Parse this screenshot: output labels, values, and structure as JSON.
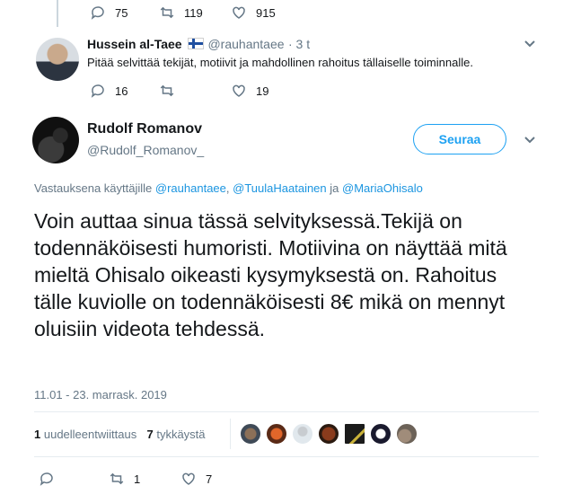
{
  "prev_tweet": {
    "replies": "75",
    "retweets": "119",
    "likes": "915"
  },
  "reply_tweet": {
    "name": "Hussein al-Taee",
    "handle": "@rauhantaee",
    "time": "· 3 t",
    "text": "Pitää selvittää tekijät, motiivit ja mahdollinen rahoitus tällaiselle toiminnalle.",
    "replies": "16",
    "retweets": "",
    "likes": "19"
  },
  "main_tweet": {
    "name": "Rudolf Romanov",
    "handle": "@Rudolf_Romanov_",
    "follow_label": "Seuraa",
    "reply_prefix": "Vastauksena käyttäjille",
    "reply_users": [
      "@rauhantaee",
      "@TuulaHaatainen",
      "@MariaOhisalo"
    ],
    "reply_sep": ",",
    "reply_and": "ja",
    "text": "Voin auttaa sinua tässä selvityksessä.Tekijä on todennäköisesti humoristi.  Motiivina on näyttää mitä mieltä Ohisalo oikeasti kysymyksestä on. Rahoitus tälle kuviolle on todennäköisesti 8€ mikä on mennyt oluisiin videota tehdessä.",
    "timestamp": "11.01 - 23. marrask. 2019",
    "retweet_count": "1",
    "retweet_label": "uudelleentwiittaus",
    "like_count": "7",
    "like_label": "tykkäystä",
    "replies": "",
    "retweets": "1",
    "likes": "7"
  },
  "icons": {
    "reply": "reply-icon",
    "retweet": "retweet-icon",
    "like": "heart-icon",
    "more": "chevron-down-icon"
  },
  "colors": {
    "accent": "#1da1f2",
    "muted": "#657786",
    "text": "#14171a"
  }
}
